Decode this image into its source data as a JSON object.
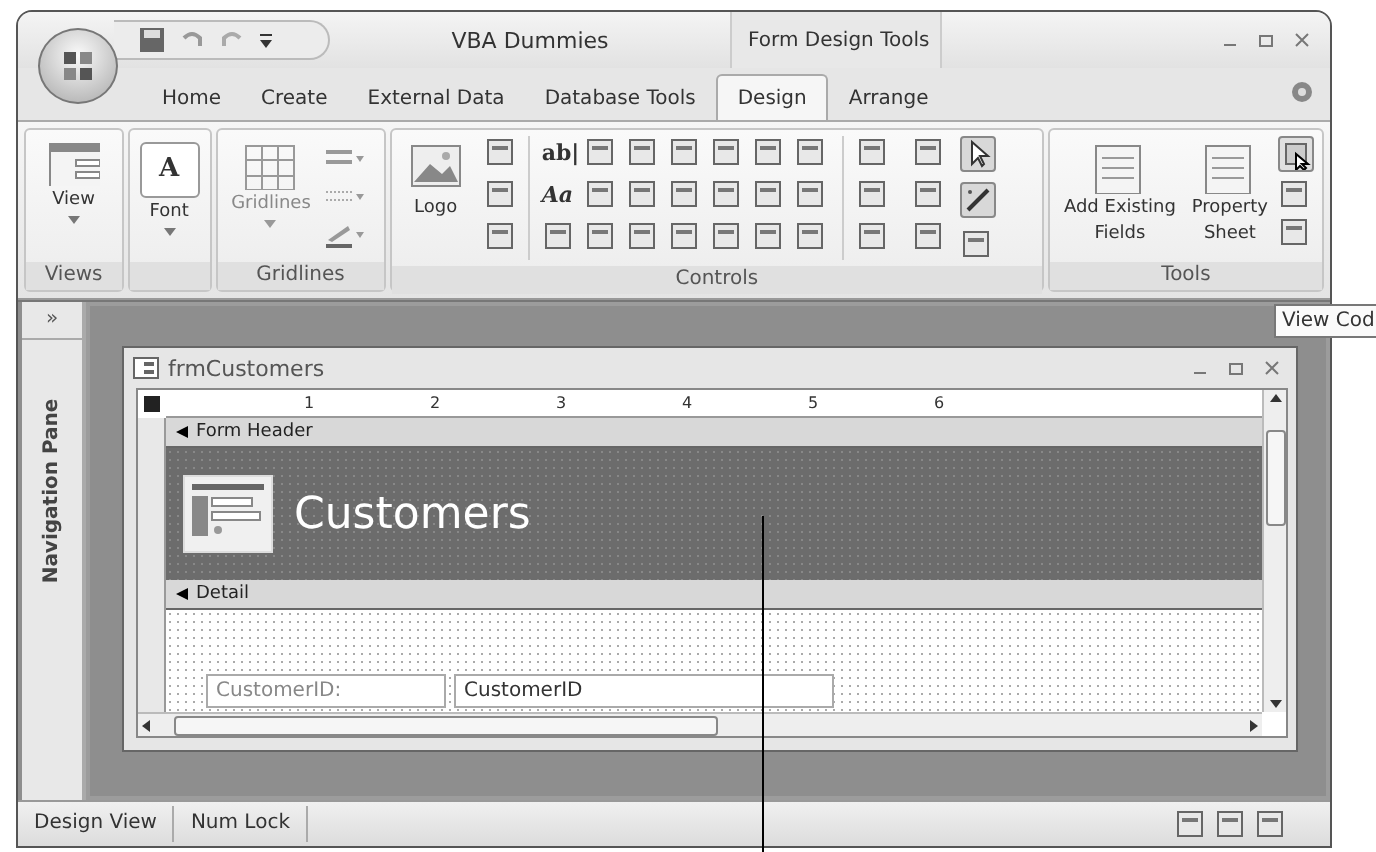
{
  "window": {
    "title": "VBA Dummies",
    "context_tab": "Form Design Tools"
  },
  "tabs": [
    {
      "label": "Home",
      "selected": false
    },
    {
      "label": "Create",
      "selected": false
    },
    {
      "label": "External Data",
      "selected": false
    },
    {
      "label": "Database Tools",
      "selected": false
    },
    {
      "label": "Design",
      "selected": true
    },
    {
      "label": "Arrange",
      "selected": false
    }
  ],
  "ribbon": {
    "views": {
      "label": "Views",
      "button": "View"
    },
    "font": {
      "button": "Font",
      "glyph": "A"
    },
    "gridlines": {
      "label": "Gridlines",
      "button": "Gridlines"
    },
    "controls": {
      "label": "Controls",
      "logo": "Logo",
      "glyphs": [
        "ab|",
        "Aa"
      ],
      "select_pressed": true,
      "wizards_pressed": true
    },
    "tools": {
      "label": "Tools",
      "buttons": [
        {
          "lines": [
            "Add Existing",
            "Fields"
          ]
        },
        {
          "lines": [
            "Property",
            "Sheet"
          ]
        }
      ],
      "view_code_hovered": true
    }
  },
  "tooltip": "View Cod",
  "navigation_pane": {
    "toggle": "»",
    "label": "Navigation Pane"
  },
  "form_window": {
    "title": "frmCustomers",
    "ruler": [
      "1",
      "2",
      "3",
      "4",
      "5",
      "6"
    ],
    "sections": [
      {
        "kind": "header",
        "label": "Form Header",
        "title": "Customers"
      },
      {
        "kind": "detail",
        "label": "Detail",
        "field_label": "CustomerID:",
        "field_value": "CustomerID"
      }
    ]
  },
  "status_bar": {
    "items": [
      "Design View",
      "Num Lock"
    ]
  }
}
